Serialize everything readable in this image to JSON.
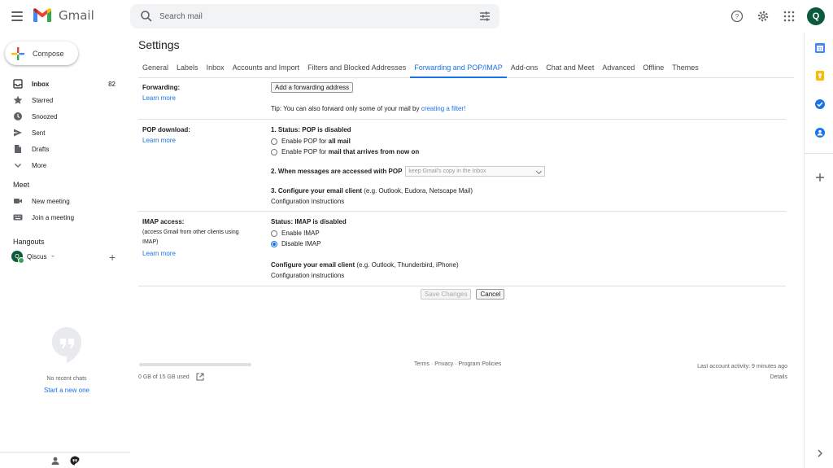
{
  "app": {
    "name": "Gmail",
    "avatar_letter": "Q",
    "brand_colors": {
      "red": "#ea4335",
      "blue": "#1a73e8",
      "green": "#0b5a3c"
    }
  },
  "search": {
    "placeholder": "Search mail"
  },
  "sidebar": {
    "compose_label": "Compose",
    "items": [
      {
        "label": "Inbox",
        "count": "82",
        "icon": "inbox-icon"
      },
      {
        "label": "Starred",
        "count": "",
        "icon": "star-icon"
      },
      {
        "label": "Snoozed",
        "count": "",
        "icon": "clock-icon"
      },
      {
        "label": "Sent",
        "count": "",
        "icon": "send-icon"
      },
      {
        "label": "Drafts",
        "count": "",
        "icon": "draft-icon"
      },
      {
        "label": "More",
        "count": "",
        "icon": "chevron-down-icon"
      }
    ],
    "meet": {
      "title": "Meet",
      "items": [
        {
          "label": "New meeting",
          "icon": "video-icon"
        },
        {
          "label": "Join a meeting",
          "icon": "keyboard-icon"
        }
      ]
    },
    "hangouts": {
      "title": "Hangouts",
      "user": "Qiscus",
      "user_initial": "Q",
      "no_chats": "No recent chats",
      "start_new": "Start a new one"
    }
  },
  "settings": {
    "title": "Settings",
    "tabs": [
      {
        "label": "General"
      },
      {
        "label": "Labels"
      },
      {
        "label": "Inbox"
      },
      {
        "label": "Accounts and Import"
      },
      {
        "label": "Filters and Blocked Addresses"
      },
      {
        "label": "Forwarding and POP/IMAP"
      },
      {
        "label": "Add-ons"
      },
      {
        "label": "Chat and Meet"
      },
      {
        "label": "Advanced"
      },
      {
        "label": "Offline"
      },
      {
        "label": "Themes"
      }
    ],
    "active_tab": "Forwarding and POP/IMAP",
    "forwarding": {
      "label": "Forwarding:",
      "learn_more": "Learn more",
      "add_button": "Add a forwarding address",
      "tip_prefix": "Tip: You can also forward only some of your mail by ",
      "tip_link": "creating a filter!"
    },
    "pop": {
      "label": "POP download:",
      "learn_more": "Learn more",
      "status": "1. Status: POP is disabled",
      "option1_prefix": "Enable POP for ",
      "option1_bold": "all mail",
      "option2_prefix": "Enable POP for ",
      "option2_bold": "mail that arrives from now on",
      "step2_label": "2. When messages are accessed with POP",
      "step2_select": "keep Gmail's copy in the Inbox",
      "step3_label": "3. Configure your email client",
      "step3_hint": " (e.g. Outlook, Eudora, Netscape Mail)",
      "config_link": "Configuration instructions"
    },
    "imap": {
      "label": "IMAP access:",
      "sub_line1": "(access Gmail from other clients using",
      "sub_line2": "IMAP)",
      "learn_more": "Learn more",
      "status": "Status: IMAP is disabled",
      "enable": "Enable IMAP",
      "disable": "Disable IMAP",
      "selected": "Disable IMAP",
      "configure_label": "Configure your email client",
      "configure_hint": " (e.g. Outlook, Thunderbird, iPhone)",
      "config_link": "Configuration instructions"
    },
    "save_button": "Save Changes",
    "cancel_button": "Cancel"
  },
  "footer": {
    "storage": "0 GB of 15 GB used",
    "storage_fraction": 0.0,
    "terms": "Terms · Privacy · Program Policies",
    "activity": "Last account activity: 9 minutes ago",
    "details": "Details"
  }
}
